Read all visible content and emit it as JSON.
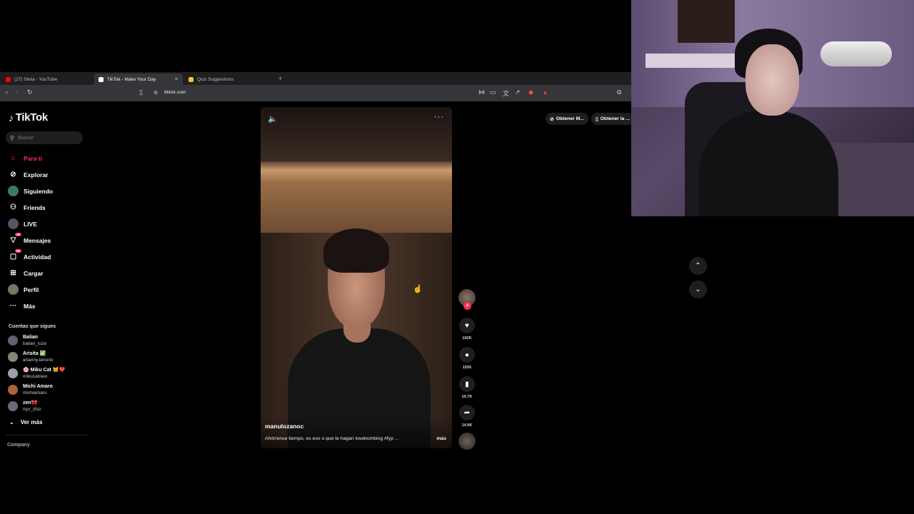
{
  "browser": {
    "tabs": [
      {
        "label": "(27) Silvia - YouTube",
        "color": "#ff0000"
      },
      {
        "label": "TikTok - Make Your Day",
        "color": "#ffffff"
      },
      {
        "label": "Quiz Suggestions",
        "color": "#f4c430"
      }
    ],
    "url": "tiktok.com"
  },
  "tiktok": {
    "logo": "TikTok",
    "search_placeholder": "Buscar",
    "nav": [
      {
        "label": "Para ti",
        "icon": "home-icon"
      },
      {
        "label": "Explorar",
        "icon": "compass-icon"
      },
      {
        "label": "Siguiendo",
        "icon": "following-icon"
      },
      {
        "label": "Friends",
        "icon": "friends-icon"
      },
      {
        "label": "LIVE",
        "icon": "live-icon"
      },
      {
        "label": "Mensajes",
        "icon": "message-icon",
        "badge": "39"
      },
      {
        "label": "Actividad",
        "icon": "activity-icon",
        "badge": "99"
      },
      {
        "label": "Cargar",
        "icon": "upload-icon"
      },
      {
        "label": "Perfil",
        "icon": "profile-icon"
      },
      {
        "label": "Más",
        "icon": "more-icon"
      }
    ],
    "following_title": "Cuentas que sigues",
    "accounts": [
      {
        "name": "Balian",
        "handle": "balian_luza"
      },
      {
        "name": "Arisita ✅",
        "handle": "arianny.tenorio"
      },
      {
        "name": "🌸 Miku Cat 🐱❤️",
        "handle": "mikucatowo"
      },
      {
        "name": "Michi Amaro",
        "handle": "michiamaro"
      },
      {
        "name": "zen🎀",
        "handle": "nyx_zfoz"
      }
    ],
    "ver_mas": "Ver más",
    "company": "Company",
    "get_buttons": [
      "Obtener M...",
      "Obtener la ..."
    ],
    "video": {
      "username": "manulozanoc",
      "description": "Ahórrense tiempo, es eso o que te hagan lovebombing #fyp ...",
      "more": "más"
    },
    "actions": {
      "likes": "192K",
      "comments": "1555",
      "saves": "19.7K",
      "shares": "14.9K"
    }
  }
}
